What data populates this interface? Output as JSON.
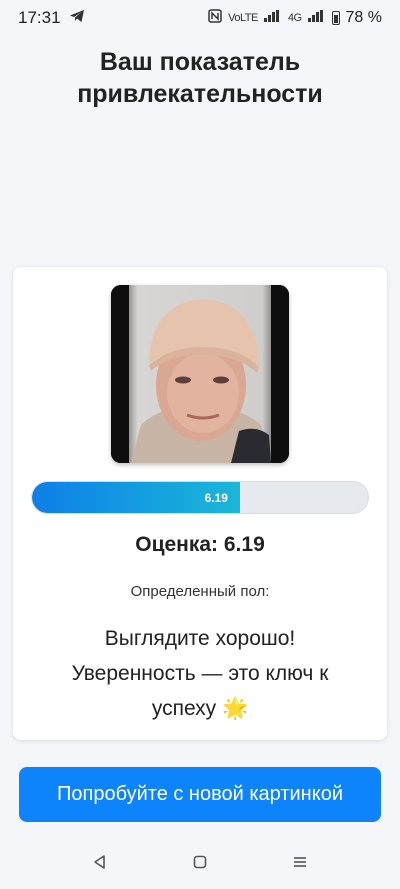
{
  "status_bar": {
    "time": "17:31",
    "network_label": "VoLTE",
    "network_type": "4G",
    "battery": "78 %"
  },
  "page": {
    "title_line1": "Ваш показатель",
    "title_line2": "привлекательности"
  },
  "result": {
    "score_label": "6.19",
    "score_progress": 0.619,
    "score_text": "Оценка: 6.19",
    "gender_label": "Определенный пол:",
    "message_line1": "Выглядите хорошо!",
    "message_line2": "Уверенность — это ключ к",
    "message_line3": "успеху 🌟"
  },
  "cta": {
    "label": "Попробуйте с новой картинкой"
  },
  "colors": {
    "accent": "#0d84fb",
    "bar_start": "#0d7fe8",
    "bar_end": "#1ab8d8",
    "background": "#f4f6f9"
  },
  "icons": {
    "telegram": "telegram-icon",
    "nfc": "nfc-icon",
    "signal": "signal-icon",
    "battery": "battery-icon",
    "back": "back-icon",
    "home": "home-icon",
    "recents": "recents-icon"
  }
}
